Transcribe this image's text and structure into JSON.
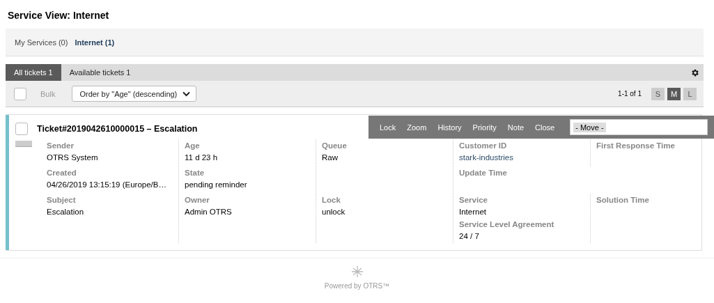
{
  "page_title": "Service View: Internet",
  "services": [
    {
      "label": "My Services (0)",
      "selected": false
    },
    {
      "label": "Internet (1)",
      "selected": true
    }
  ],
  "filter_tabs": [
    {
      "label": "All tickets",
      "count": "1",
      "selected": true
    },
    {
      "label": "Available tickets",
      "count": "1",
      "selected": false
    }
  ],
  "toolbar": {
    "select_all_checked": false,
    "bulk_label": "Bulk",
    "bulk_disabled": true,
    "order_by": "Order by \"Age\" (descending)",
    "pagination": "1-1 of 1",
    "view_sizes": [
      {
        "label": "S",
        "selected": false
      },
      {
        "label": "M",
        "selected": true
      },
      {
        "label": "L",
        "selected": false
      }
    ]
  },
  "ticket": {
    "title": "Ticket#2019042610000015 – Escalation",
    "checked": false,
    "color": "#76bfcd",
    "actions": [
      "Lock",
      "Zoom",
      "History",
      "Priority",
      "Note",
      "Close"
    ],
    "move_select": "- Move -",
    "rows": [
      [
        [
          {
            "label": "Sender",
            "value": "OTRS System"
          }
        ],
        [
          {
            "label": "Age",
            "value": "11 d 23 h"
          }
        ],
        [
          {
            "label": "Queue",
            "value": "Raw"
          }
        ],
        [
          {
            "label": "Customer ID",
            "value": "stark-industries",
            "kind": "link"
          }
        ],
        [
          {
            "label": "First Response Time"
          }
        ]
      ],
      [
        [
          {
            "label": "Created",
            "value": "04/26/2019 13:15:19 (Europe/B…"
          }
        ],
        [
          {
            "label": "State",
            "value": "pending reminder"
          }
        ],
        null,
        [
          {
            "label": "Update Time"
          }
        ],
        null
      ],
      [
        [
          {
            "label": "Subject",
            "value": "Escalation"
          }
        ],
        [
          {
            "label": "Owner",
            "value": "Admin OTRS"
          }
        ],
        [
          {
            "label": "Lock",
            "value": "unlock"
          }
        ],
        [
          {
            "label": "Service",
            "value": "Internet"
          },
          {
            "label": "Service Level Agreement",
            "value": "24 / 7"
          }
        ],
        [
          {
            "label": "Solution Time"
          }
        ]
      ]
    ]
  },
  "footer": "Powered by OTRS™"
}
